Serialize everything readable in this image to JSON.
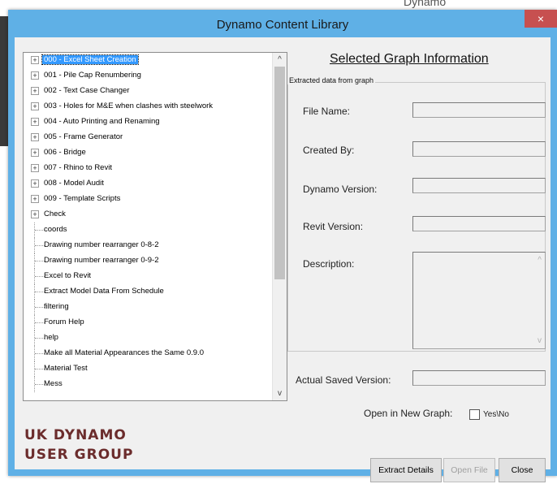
{
  "window": {
    "title": "Dynamo Content Library",
    "close_glyph": "×",
    "background_text": "Dynamo"
  },
  "tree": {
    "items": [
      {
        "label": "000 - Excel Sheet Creation",
        "expandable": true,
        "selected": true
      },
      {
        "label": "001 - Pile Cap Renumbering",
        "expandable": true
      },
      {
        "label": "002 - Text Case Changer",
        "expandable": true
      },
      {
        "label": "003 - Holes for M&E when clashes with steelwork",
        "expandable": true
      },
      {
        "label": "004 - Auto Printing and Renaming",
        "expandable": true
      },
      {
        "label": "005 - Frame Generator",
        "expandable": true
      },
      {
        "label": "006 - Bridge",
        "expandable": true
      },
      {
        "label": "007 - Rhino to Revit",
        "expandable": true
      },
      {
        "label": "008 - Model Audit",
        "expandable": true
      },
      {
        "label": "009 - Template Scripts",
        "expandable": true
      },
      {
        "label": "Check",
        "expandable": true
      },
      {
        "label": "coords",
        "expandable": false
      },
      {
        "label": "Drawing number rearranger 0-8-2",
        "expandable": false
      },
      {
        "label": "Drawing number rearranger 0-9-2",
        "expandable": false
      },
      {
        "label": "Excel to Revit",
        "expandable": false
      },
      {
        "label": "Extract Model Data From Schedule",
        "expandable": false
      },
      {
        "label": "filtering",
        "expandable": false
      },
      {
        "label": "Forum Help",
        "expandable": false
      },
      {
        "label": "help",
        "expandable": false
      },
      {
        "label": "Make all Material Appearances the Same 0.9.0",
        "expandable": false
      },
      {
        "label": "Material Test",
        "expandable": false
      },
      {
        "label": "Mess",
        "expandable": false
      }
    ],
    "scroll_up_glyph": "^",
    "scroll_down_glyph": "v"
  },
  "info": {
    "heading": "Selected Graph Information",
    "group_legend": "Extracted data from graph",
    "fields": {
      "file_name": {
        "label": "File Name:",
        "value": ""
      },
      "created_by": {
        "label": "Created By:",
        "value": ""
      },
      "dynamo_version": {
        "label": "Dynamo Version:",
        "value": ""
      },
      "revit_version": {
        "label": "Revit Version:",
        "value": ""
      },
      "description": {
        "label": "Description:",
        "value": ""
      },
      "actual_saved_version": {
        "label": "Actual Saved Version:",
        "value": ""
      }
    }
  },
  "options": {
    "open_in_new_graph_label": "Open in New Graph:",
    "checkbox_label": "Yes\\No",
    "checked": false
  },
  "logo": {
    "line1": "UK DYNAMO",
    "line2": "USER GROUP"
  },
  "buttons": {
    "extract": "Extract Details",
    "open": "Open File",
    "close": "Close"
  }
}
